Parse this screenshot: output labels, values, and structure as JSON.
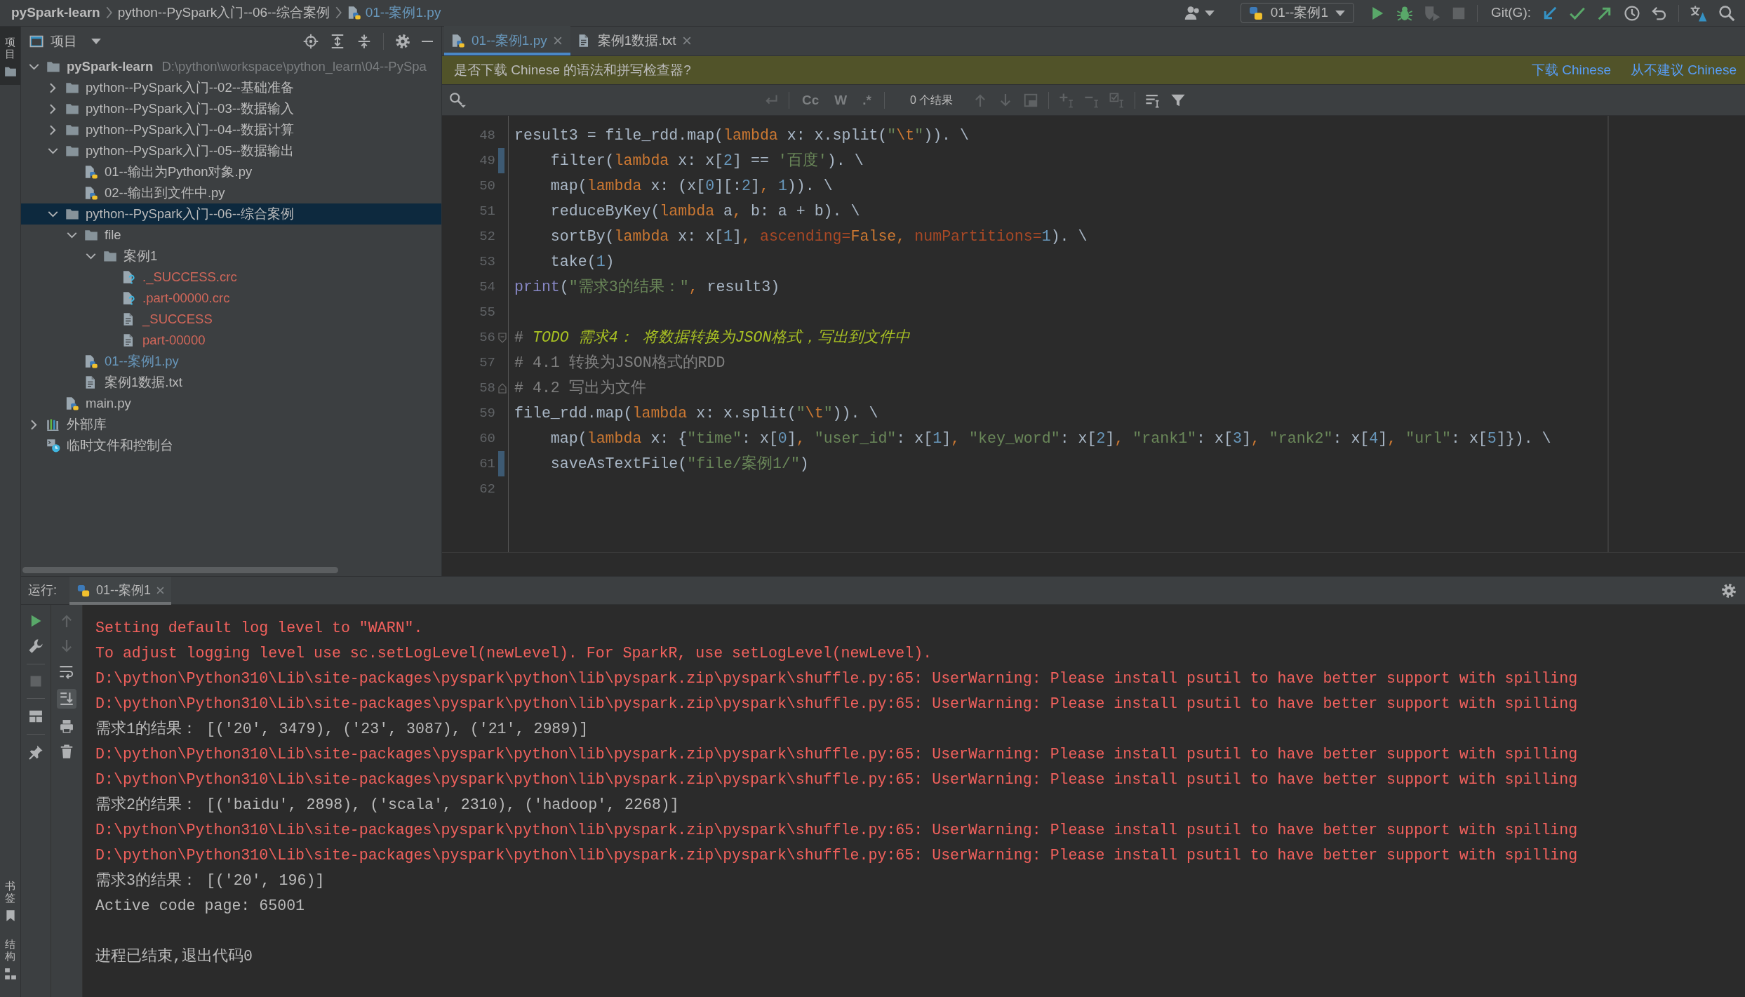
{
  "breadcrumb": [
    {
      "label": "pySpark-learn",
      "kind": "project",
      "modified": false
    },
    {
      "label": "python--PySpark入门--06--综合案例",
      "kind": "folder",
      "modified": false
    },
    {
      "label": "01--案例1.py",
      "kind": "python",
      "modified": true
    }
  ],
  "toolbar": {
    "run_config": "01--案例1",
    "git_label": "Git(G):"
  },
  "side_strip": {
    "top": [
      {
        "label": "项目",
        "selected": true
      }
    ],
    "bottom": [
      {
        "label": "书签",
        "selected": false
      },
      {
        "label": "结构",
        "selected": false
      }
    ]
  },
  "project_panel": {
    "title": "项目",
    "tree": [
      {
        "label": "pySpark-learn",
        "path": "D:\\python\\workspace\\python_learn\\04--PySpa",
        "kind": "project",
        "expanded": true,
        "selected": false,
        "modified": false,
        "untracked": false,
        "children": [
          {
            "label": "python--PySpark入门--02--基础准备",
            "kind": "folder",
            "expanded": false,
            "selected": false,
            "modified": false,
            "untracked": false
          },
          {
            "label": "python--PySpark入门--03--数据输入",
            "kind": "folder",
            "expanded": false,
            "selected": false,
            "modified": false,
            "untracked": false
          },
          {
            "label": "python--PySpark入门--04--数据计算",
            "kind": "folder",
            "expanded": false,
            "selected": false,
            "modified": false,
            "untracked": false
          },
          {
            "label": "python--PySpark入门--05--数据输出",
            "kind": "folder",
            "expanded": true,
            "selected": false,
            "modified": false,
            "untracked": false,
            "children": [
              {
                "label": "01--输出为Python对象.py",
                "kind": "python",
                "selected": false,
                "modified": false,
                "untracked": false
              },
              {
                "label": "02--输出到文件中.py",
                "kind": "python",
                "selected": false,
                "modified": false,
                "untracked": false
              }
            ]
          },
          {
            "label": "python--PySpark入门--06--综合案例",
            "kind": "folder",
            "expanded": true,
            "selected": true,
            "modified": false,
            "untracked": false,
            "children": [
              {
                "label": "file",
                "kind": "folder",
                "expanded": true,
                "selected": false,
                "modified": false,
                "untracked": false,
                "children": [
                  {
                    "label": "案例1",
                    "kind": "folder",
                    "expanded": true,
                    "selected": false,
                    "modified": false,
                    "untracked": false,
                    "children": [
                      {
                        "label": "._SUCCESS.crc",
                        "kind": "unknown",
                        "selected": false,
                        "modified": false,
                        "untracked": true
                      },
                      {
                        "label": ".part-00000.crc",
                        "kind": "unknown",
                        "selected": false,
                        "modified": false,
                        "untracked": true
                      },
                      {
                        "label": "_SUCCESS",
                        "kind": "text",
                        "selected": false,
                        "modified": false,
                        "untracked": true
                      },
                      {
                        "label": "part-00000",
                        "kind": "text",
                        "selected": false,
                        "modified": false,
                        "untracked": true
                      }
                    ]
                  }
                ]
              },
              {
                "label": "01--案例1.py",
                "kind": "python",
                "selected": false,
                "modified": true,
                "untracked": false
              },
              {
                "label": "案例1数据.txt",
                "kind": "text",
                "selected": false,
                "modified": false,
                "untracked": false
              }
            ]
          },
          {
            "label": "main.py",
            "kind": "python",
            "selected": false,
            "modified": false,
            "untracked": false
          }
        ]
      },
      {
        "label": "外部库",
        "kind": "library",
        "expanded": false,
        "selected": false,
        "modified": false,
        "untracked": false
      },
      {
        "label": "临时文件和控制台",
        "kind": "scratch",
        "selected": false,
        "modified": false,
        "untracked": false
      }
    ]
  },
  "editor": {
    "tabs": [
      {
        "label": "01--案例1.py",
        "kind": "python",
        "selected": true,
        "modified": true
      },
      {
        "label": "案例1数据.txt",
        "kind": "text",
        "selected": false,
        "modified": false
      }
    ],
    "notification": {
      "text": "是否下载 Chinese 的语法和拼写检查器?",
      "actions": [
        "下载 Chinese",
        "从不建议 Chinese"
      ]
    },
    "search": {
      "options": [
        "Cc",
        "W",
        ".*"
      ],
      "result_count": "0 个结果"
    },
    "lines": [
      {
        "number": "48",
        "changed": false,
        "fold_start": false,
        "fold_end": false,
        "tokens": [
          {
            "text": "result3 = file_rdd.map(",
            "kind": "plain"
          },
          {
            "text": "lambda",
            "kind": "keyword"
          },
          {
            "text": " x: x.split(",
            "kind": "plain"
          },
          {
            "text": "\"",
            "kind": "string"
          },
          {
            "text": "\\t",
            "kind": "escape"
          },
          {
            "text": "\"",
            "kind": "string"
          },
          {
            "text": ")). \\",
            "kind": "plain"
          }
        ]
      },
      {
        "number": "49",
        "changed": true,
        "fold_start": false,
        "fold_end": false,
        "tokens": [
          {
            "text": "    filter(",
            "kind": "plain"
          },
          {
            "text": "lambda",
            "kind": "keyword"
          },
          {
            "text": " x: x[",
            "kind": "plain"
          },
          {
            "text": "2",
            "kind": "number"
          },
          {
            "text": "] == ",
            "kind": "plain"
          },
          {
            "text": "'百度'",
            "kind": "string"
          },
          {
            "text": "). \\",
            "kind": "plain"
          }
        ]
      },
      {
        "number": "50",
        "changed": false,
        "fold_start": false,
        "fold_end": false,
        "tokens": [
          {
            "text": "    map(",
            "kind": "plain"
          },
          {
            "text": "lambda",
            "kind": "keyword"
          },
          {
            "text": " x: (x[",
            "kind": "plain"
          },
          {
            "text": "0",
            "kind": "number"
          },
          {
            "text": "][:",
            "kind": "plain"
          },
          {
            "text": "2",
            "kind": "number"
          },
          {
            "text": "]",
            "kind": "plain"
          },
          {
            "text": ", ",
            "kind": "keyword"
          },
          {
            "text": "1",
            "kind": "number"
          },
          {
            "text": ")). \\",
            "kind": "plain"
          }
        ]
      },
      {
        "number": "51",
        "changed": false,
        "fold_start": false,
        "fold_end": false,
        "tokens": [
          {
            "text": "    reduceByKey(",
            "kind": "plain"
          },
          {
            "text": "lambda",
            "kind": "keyword"
          },
          {
            "text": " a",
            "kind": "plain"
          },
          {
            "text": ", ",
            "kind": "keyword"
          },
          {
            "text": "b: a + b). \\",
            "kind": "plain"
          }
        ]
      },
      {
        "number": "52",
        "changed": false,
        "fold_start": false,
        "fold_end": false,
        "tokens": [
          {
            "text": "    sortBy(",
            "kind": "plain"
          },
          {
            "text": "lambda",
            "kind": "keyword"
          },
          {
            "text": " x: x[",
            "kind": "plain"
          },
          {
            "text": "1",
            "kind": "number"
          },
          {
            "text": "]",
            "kind": "plain"
          },
          {
            "text": ", ",
            "kind": "keyword"
          },
          {
            "text": "ascending=",
            "kind": "param"
          },
          {
            "text": "False",
            "kind": "keyword"
          },
          {
            "text": ", ",
            "kind": "keyword"
          },
          {
            "text": "numPartitions=",
            "kind": "param"
          },
          {
            "text": "1",
            "kind": "number"
          },
          {
            "text": "). \\",
            "kind": "plain"
          }
        ]
      },
      {
        "number": "53",
        "changed": false,
        "fold_start": false,
        "fold_end": false,
        "tokens": [
          {
            "text": "    take(",
            "kind": "plain"
          },
          {
            "text": "1",
            "kind": "number"
          },
          {
            "text": ")",
            "kind": "plain"
          }
        ]
      },
      {
        "number": "54",
        "changed": false,
        "fold_start": false,
        "fold_end": false,
        "tokens": [
          {
            "text": "print",
            "kind": "builtin"
          },
          {
            "text": "(",
            "kind": "plain"
          },
          {
            "text": "\"需求3的结果：\"",
            "kind": "string"
          },
          {
            "text": ", ",
            "kind": "keyword"
          },
          {
            "text": "result3)",
            "kind": "plain"
          }
        ]
      },
      {
        "number": "55",
        "changed": false,
        "fold_start": false,
        "fold_end": false
      },
      {
        "number": "56",
        "changed": false,
        "fold_start": true,
        "fold_end": false,
        "tokens": [
          {
            "text": "# ",
            "kind": "comment"
          },
          {
            "text": "TODO 需求4： 将数据转换为JSON格式，写出到文件中",
            "kind": "todo"
          }
        ]
      },
      {
        "number": "57",
        "changed": false,
        "fold_start": false,
        "fold_end": false,
        "tokens": [
          {
            "text": "# 4.1 转换为JSON格式的RDD",
            "kind": "comment"
          }
        ]
      },
      {
        "number": "58",
        "changed": false,
        "fold_start": false,
        "fold_end": true,
        "tokens": [
          {
            "text": "# 4.2 写出为文件",
            "kind": "comment"
          }
        ]
      },
      {
        "number": "59",
        "changed": false,
        "fold_start": false,
        "fold_end": false,
        "tokens": [
          {
            "text": "file_rdd.map(",
            "kind": "plain"
          },
          {
            "text": "lambda",
            "kind": "keyword"
          },
          {
            "text": " x: x.split(",
            "kind": "plain"
          },
          {
            "text": "\"",
            "kind": "string"
          },
          {
            "text": "\\t",
            "kind": "escape"
          },
          {
            "text": "\"",
            "kind": "string"
          },
          {
            "text": ")). \\",
            "kind": "plain"
          }
        ]
      },
      {
        "number": "60",
        "changed": false,
        "fold_start": false,
        "fold_end": false,
        "tokens": [
          {
            "text": "    map(",
            "kind": "plain"
          },
          {
            "text": "lambda",
            "kind": "keyword"
          },
          {
            "text": " x: {",
            "kind": "plain"
          },
          {
            "text": "\"time\"",
            "kind": "string"
          },
          {
            "text": ": x[",
            "kind": "plain"
          },
          {
            "text": "0",
            "kind": "number"
          },
          {
            "text": "]",
            "kind": "plain"
          },
          {
            "text": ", ",
            "kind": "keyword"
          },
          {
            "text": "\"user_id\"",
            "kind": "string"
          },
          {
            "text": ": x[",
            "kind": "plain"
          },
          {
            "text": "1",
            "kind": "number"
          },
          {
            "text": "]",
            "kind": "plain"
          },
          {
            "text": ", ",
            "kind": "keyword"
          },
          {
            "text": "\"key_word\"",
            "kind": "string"
          },
          {
            "text": ": x[",
            "kind": "plain"
          },
          {
            "text": "2",
            "kind": "number"
          },
          {
            "text": "]",
            "kind": "plain"
          },
          {
            "text": ", ",
            "kind": "keyword"
          },
          {
            "text": "\"rank1\"",
            "kind": "string"
          },
          {
            "text": ": x[",
            "kind": "plain"
          },
          {
            "text": "3",
            "kind": "number"
          },
          {
            "text": "]",
            "kind": "plain"
          },
          {
            "text": ", ",
            "kind": "keyword"
          },
          {
            "text": "\"rank2\"",
            "kind": "string"
          },
          {
            "text": ": x[",
            "kind": "plain"
          },
          {
            "text": "4",
            "kind": "number"
          },
          {
            "text": "]",
            "kind": "plain"
          },
          {
            "text": ", ",
            "kind": "keyword"
          },
          {
            "text": "\"url\"",
            "kind": "string"
          },
          {
            "text": ": x[",
            "kind": "plain"
          },
          {
            "text": "5",
            "kind": "number"
          },
          {
            "text": "]}). \\",
            "kind": "plain"
          }
        ]
      },
      {
        "number": "61",
        "changed": true,
        "fold_start": false,
        "fold_end": false,
        "tokens": [
          {
            "text": "    saveAsTextFile(",
            "kind": "plain"
          },
          {
            "text": "\"file/案例1/\"",
            "kind": "string"
          },
          {
            "text": ")",
            "kind": "plain"
          }
        ]
      },
      {
        "number": "62",
        "changed": false,
        "fold_start": false,
        "fold_end": false
      }
    ]
  },
  "run_panel": {
    "label": "运行:",
    "tabs": [
      {
        "label": "01--案例1",
        "selected": true
      }
    ],
    "console": [
      {
        "text": "Setting default log level to \"WARN\".",
        "kind": "stderr"
      },
      {
        "text": "To adjust logging level use sc.setLogLevel(newLevel). For SparkR, use setLogLevel(newLevel).",
        "kind": "stderr"
      },
      {
        "text": "D:\\python\\Python310\\Lib\\site-packages\\pyspark\\python\\lib\\pyspark.zip\\pyspark\\shuffle.py:65: UserWarning: Please install psutil to have better support with spilling",
        "kind": "stderr"
      },
      {
        "text": "D:\\python\\Python310\\Lib\\site-packages\\pyspark\\python\\lib\\pyspark.zip\\pyspark\\shuffle.py:65: UserWarning: Please install psutil to have better support with spilling",
        "kind": "stderr"
      },
      {
        "text": "需求1的结果： [('20', 3479), ('23', 3087), ('21', 2989)]",
        "kind": "stdout"
      },
      {
        "text": "D:\\python\\Python310\\Lib\\site-packages\\pyspark\\python\\lib\\pyspark.zip\\pyspark\\shuffle.py:65: UserWarning: Please install psutil to have better support with spilling",
        "kind": "stderr"
      },
      {
        "text": "D:\\python\\Python310\\Lib\\site-packages\\pyspark\\python\\lib\\pyspark.zip\\pyspark\\shuffle.py:65: UserWarning: Please install psutil to have better support with spilling",
        "kind": "stderr"
      },
      {
        "text": "需求2的结果： [('baidu', 2898), ('scala', 2310), ('hadoop', 2268)]",
        "kind": "stdout"
      },
      {
        "text": "D:\\python\\Python310\\Lib\\site-packages\\pyspark\\python\\lib\\pyspark.zip\\pyspark\\shuffle.py:65: UserWarning: Please install psutil to have better support with spilling",
        "kind": "stderr"
      },
      {
        "text": "D:\\python\\Python310\\Lib\\site-packages\\pyspark\\python\\lib\\pyspark.zip\\pyspark\\shuffle.py:65: UserWarning: Please install psutil to have better support with spilling",
        "kind": "stderr"
      },
      {
        "text": "需求3的结果： [('20', 196)]",
        "kind": "stdout"
      },
      {
        "text": "Active code page: 65001",
        "kind": "stdout"
      },
      {
        "text": "进程已结束,退出代码0",
        "kind": "exit"
      }
    ]
  }
}
